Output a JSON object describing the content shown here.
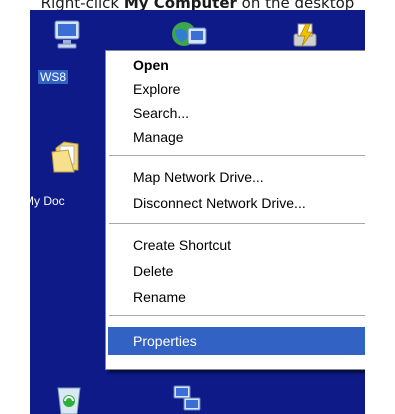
{
  "caption": {
    "prefix": "Right-click ",
    "bold": "My Computer",
    "suffix": " on the desktop"
  },
  "desktop": {
    "icons": [
      {
        "label": "WS8"
      },
      {
        "label": "My Doc"
      }
    ]
  },
  "context_menu": {
    "items": [
      {
        "label": "Open",
        "bold": true
      },
      {
        "label": "Explore"
      },
      {
        "label": "Search..."
      },
      {
        "label": "Manage"
      },
      {
        "label": "Map Network Drive..."
      },
      {
        "label": "Disconnect Network Drive..."
      },
      {
        "label": "Create Shortcut"
      },
      {
        "label": "Delete"
      },
      {
        "label": "Rename"
      },
      {
        "label": "Properties",
        "highlighted": true
      }
    ]
  },
  "colors": {
    "desktop_bg": "#0d1a88",
    "menu_highlight": "#3162c4",
    "menu_bg": "#ffffff"
  }
}
